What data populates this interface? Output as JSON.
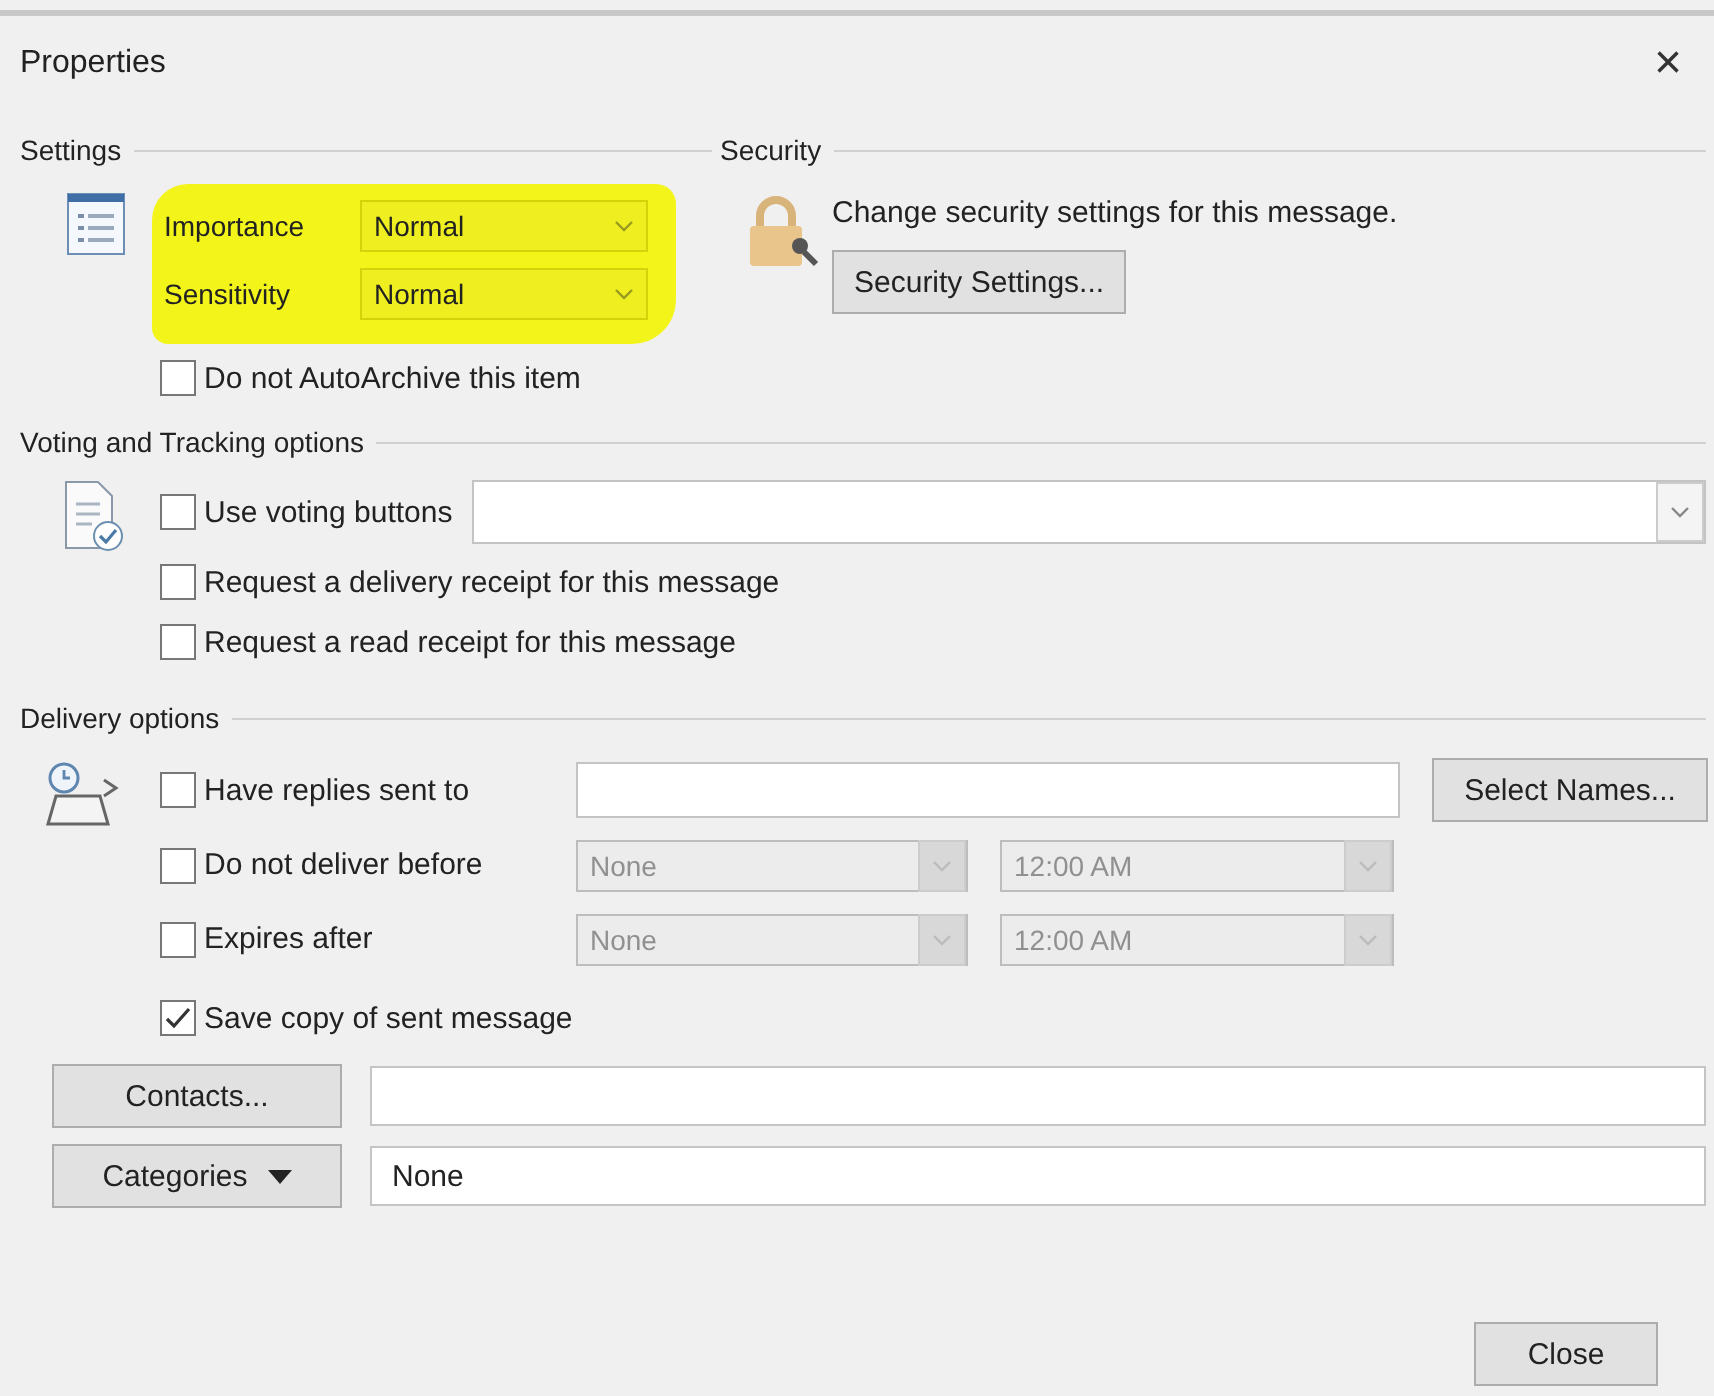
{
  "window": {
    "title": "Properties",
    "close": "×"
  },
  "settings": {
    "label": "Settings",
    "highlighted": true,
    "fields": [
      {
        "label": "Importance",
        "value": "Normal"
      },
      {
        "label": "Sensitivity",
        "value": "Normal"
      }
    ],
    "auto_archive": {
      "label": "Do not AutoArchive this item",
      "checked": false
    }
  },
  "security": {
    "label": "Security",
    "text": "Change security settings for this message.",
    "button": "Security Settings..."
  },
  "voting": {
    "label": "Voting and Tracking options",
    "options": [
      {
        "kind": "combo",
        "label": "Use voting buttons",
        "checked": false
      },
      {
        "kind": "plain",
        "label": "Request a delivery receipt for this message",
        "checked": false
      },
      {
        "kind": "plain",
        "label": "Request a read receipt for this message",
        "checked": false
      }
    ]
  },
  "delivery": {
    "label": "Delivery options",
    "rows": [
      {
        "kind": "text",
        "label": "Have replies sent to",
        "checked": false,
        "button": "Select Names..."
      },
      {
        "kind": "datetime",
        "label": "Do not deliver before",
        "checked": false,
        "disabled": true,
        "date": "None",
        "time": "12:00 AM"
      },
      {
        "kind": "datetime",
        "label": "Expires after",
        "checked": false,
        "disabled": true,
        "date": "None",
        "time": "12:00 AM"
      },
      {
        "kind": "plain",
        "label": "Save copy of sent message",
        "checked": true
      }
    ]
  },
  "contacts": {
    "button": "Contacts..."
  },
  "categories": {
    "button": "Categories",
    "value": "None"
  },
  "close_button": "Close"
}
